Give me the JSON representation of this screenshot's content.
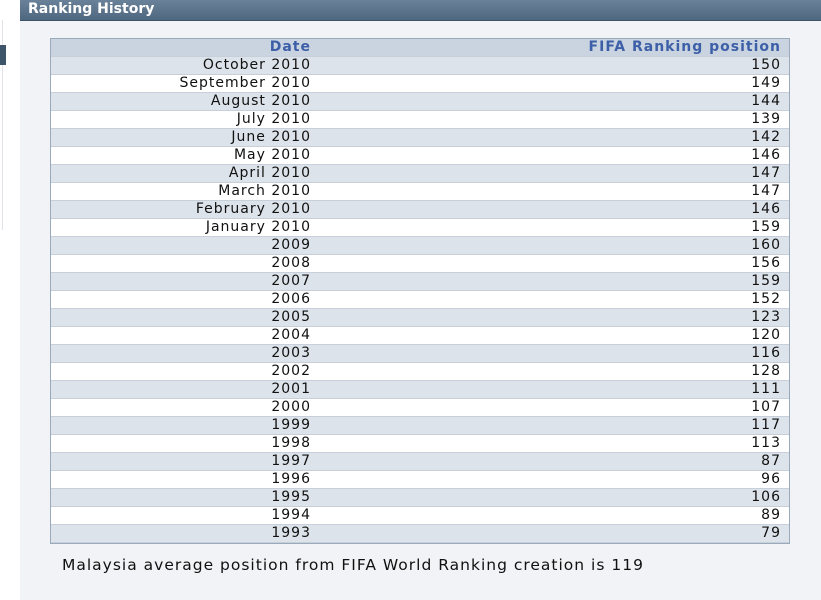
{
  "panel": {
    "title": "Ranking History"
  },
  "table": {
    "headers": {
      "date": "Date",
      "position": "FIFA Ranking position"
    },
    "rows": [
      {
        "date": "October 2010",
        "position": "150"
      },
      {
        "date": "September 2010",
        "position": "149"
      },
      {
        "date": "August 2010",
        "position": "144"
      },
      {
        "date": "July 2010",
        "position": "139"
      },
      {
        "date": "June 2010",
        "position": "142"
      },
      {
        "date": "May 2010",
        "position": "146"
      },
      {
        "date": "April 2010",
        "position": "147"
      },
      {
        "date": "March 2010",
        "position": "147"
      },
      {
        "date": "February 2010",
        "position": "146"
      },
      {
        "date": "January 2010",
        "position": "159"
      },
      {
        "date": "2009",
        "position": "160"
      },
      {
        "date": "2008",
        "position": "156"
      },
      {
        "date": "2007",
        "position": "159"
      },
      {
        "date": "2006",
        "position": "152"
      },
      {
        "date": "2005",
        "position": "123"
      },
      {
        "date": "2004",
        "position": "120"
      },
      {
        "date": "2003",
        "position": "116"
      },
      {
        "date": "2002",
        "position": "128"
      },
      {
        "date": "2001",
        "position": "111"
      },
      {
        "date": "2000",
        "position": "107"
      },
      {
        "date": "1999",
        "position": "117"
      },
      {
        "date": "1998",
        "position": "113"
      },
      {
        "date": "1997",
        "position": "87"
      },
      {
        "date": "1996",
        "position": "96"
      },
      {
        "date": "1995",
        "position": "106"
      },
      {
        "date": "1994",
        "position": "89"
      },
      {
        "date": "1993",
        "position": "79"
      }
    ]
  },
  "summary": {
    "text": "Malaysia average position from FIFA World Ranking creation is 119"
  }
}
